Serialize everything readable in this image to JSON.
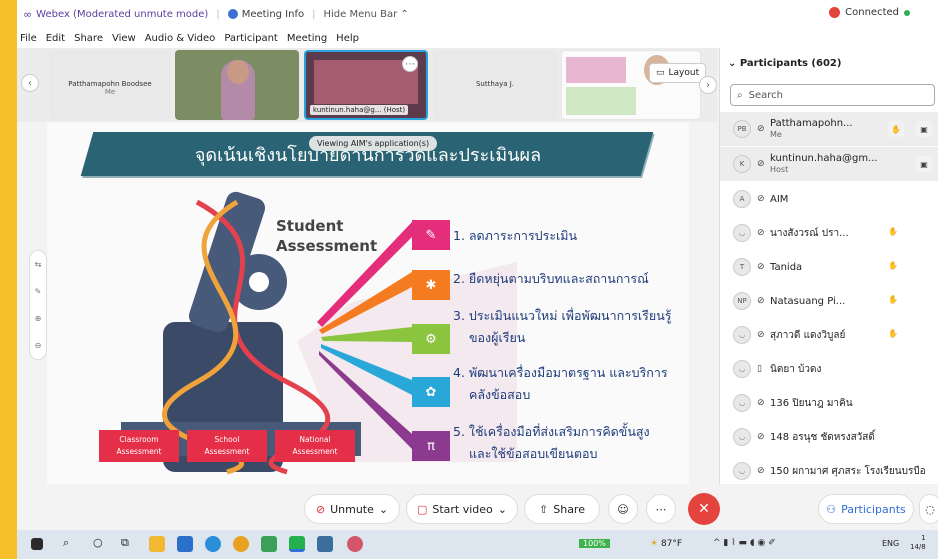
{
  "titlebar": {
    "app_title": "Webex (Moderated unmute mode)",
    "meeting_info": "Meeting Info",
    "hide_menu": "Hide Menu Bar",
    "connection": "Connected"
  },
  "menu": [
    "File",
    "Edit",
    "Share",
    "View",
    "Audio & Video",
    "Participant",
    "Meeting",
    "Help"
  ],
  "video_strip": {
    "tile1_name": "Patthamapohn Boodsee",
    "tile1_sub": "Me",
    "tile3_label": "kuntinun.haha@g...",
    "tile3_host": "(Host)",
    "tile4_name": "Sutthaya J.",
    "layout_label": "Layout"
  },
  "slide": {
    "banner": "จุดเน้นเชิงนโยบายด้านการวัดและประเมินผล",
    "viewing": "Viewing AIM's application(s)",
    "sa_title_1": "Student",
    "sa_title_2": "Assessment",
    "items": [
      {
        "line1": "1. ลดภาระการประเมิน",
        "line2": ""
      },
      {
        "line1": "2. ยืดหยุ่นตามบริบทและสถานการณ์",
        "line2": ""
      },
      {
        "line1": "3. ประเมินแนวใหม่ เพื่อพัฒนาการเรียนรู้",
        "line2": "ของผู้เรียน"
      },
      {
        "line1": "4. พัฒนาเครื่องมือมาตรฐาน และบริการ",
        "line2": "คลังข้อสอบ"
      },
      {
        "line1": "5. ใช้เครื่องมือที่ส่งเสริมการคิดขั้นสูง",
        "line2": "และใช้ข้อสอบเขียนตอบ"
      }
    ],
    "btm": [
      {
        "a": "Classroom",
        "b": "Assessment"
      },
      {
        "a": "School",
        "b": "Assessment"
      },
      {
        "a": "National",
        "b": "Assessment"
      }
    ]
  },
  "participants": {
    "header": "Participants (602)",
    "search_placeholder": "Search",
    "rows": [
      {
        "initials": "PB",
        "name": "Patthamapohn...",
        "role": "Me"
      },
      {
        "initials": "K",
        "name": "kuntinun.haha@gm...",
        "role": "Host"
      },
      {
        "initials": "A",
        "name": "AIM",
        "role": ""
      },
      {
        "initials": "",
        "name": "นางสังวรณ์ ปรา...",
        "role": ""
      },
      {
        "initials": "T",
        "name": "Tanida",
        "role": ""
      },
      {
        "initials": "NP",
        "name": "Natasuang Pi...",
        "role": ""
      },
      {
        "initials": "",
        "name": "สุภาวดี แดงวิบูลย์",
        "role": ""
      },
      {
        "initials": "",
        "name": "นิตยา บ้วดง",
        "role": ""
      },
      {
        "initials": "",
        "name": "136 ปิยนาฎ มาคิน",
        "role": ""
      },
      {
        "initials": "",
        "name": "148 อรนุช ชัดหรงสวัสดิ์",
        "role": ""
      },
      {
        "initials": "",
        "name": "150 ผกามาศ ศุภสระ โรงเรียนบรบือ",
        "role": ""
      }
    ]
  },
  "controls": {
    "unmute": "Unmute",
    "start_video": "Start video",
    "share": "Share",
    "participants": "Participants"
  },
  "taskbar": {
    "battery": "100%",
    "temp": "87°F",
    "lang": "ENG",
    "time": "1",
    "date": "14/8"
  }
}
